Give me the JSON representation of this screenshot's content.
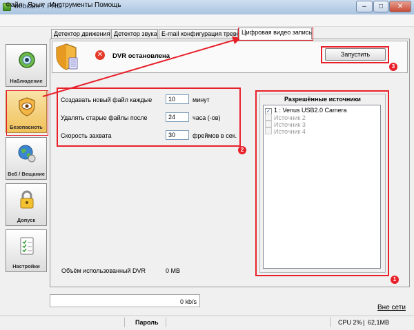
{
  "window": {
    "title": "webcam 7 PRO",
    "buttons": [
      "–",
      "□",
      "✕"
    ]
  },
  "menu": [
    "Файл",
    "Язык",
    "Инструменты",
    "Помощь"
  ],
  "nav": [
    {
      "label": "Наблюдение",
      "icon": "eye-icon",
      "active": false
    },
    {
      "label": "Безопасноть",
      "icon": "shield-eye-icon",
      "active": true
    },
    {
      "label": "Веб / Вещание",
      "icon": "globe-icon",
      "active": false
    },
    {
      "label": "Допуск",
      "icon": "padlock-icon",
      "active": false
    },
    {
      "label": "Настройки",
      "icon": "checklist-icon",
      "active": false
    }
  ],
  "tabs": [
    "Детектор движения",
    "Детектор звука",
    "E-mail конфигурация тревог",
    "Цифровая видео запись"
  ],
  "active_tab": 3,
  "dvr": {
    "status": "DVR остановлена",
    "status_icon": "error-icon",
    "start_button": "Запустить"
  },
  "settings": {
    "new_file_label": "Создавать новый файл каждые",
    "new_file_value": "10",
    "new_file_unit": "минут",
    "delete_label": "Удалять старые файлы после",
    "delete_value": "24",
    "delete_unit": "часа (-ов)",
    "speed_label": "Скорость захвата",
    "speed_value": "30",
    "speed_unit": "фреймов в сек."
  },
  "sources": {
    "title": "Разрешённые источники",
    "items": [
      {
        "label": "1 : Venus USB2.0 Camera",
        "checked": true,
        "enabled": true
      },
      {
        "label": "Источник 2",
        "checked": false,
        "enabled": false
      },
      {
        "label": "Источник 3",
        "checked": false,
        "enabled": false
      },
      {
        "label": "Источник 4",
        "checked": false,
        "enabled": false
      }
    ]
  },
  "dvr_volume": {
    "label": "Объём использованный DVR",
    "value": "0 MB"
  },
  "bandwidth": "0 kb/s",
  "offline_link": "Вне сети",
  "statusbar": {
    "password": "Пароль",
    "cpu": "CPU 2%",
    "memory": "62,1MB"
  },
  "annotations": [
    "1",
    "2",
    "3"
  ],
  "colors": {
    "annotation": "#e8202a",
    "accent": "#f0c15a"
  }
}
